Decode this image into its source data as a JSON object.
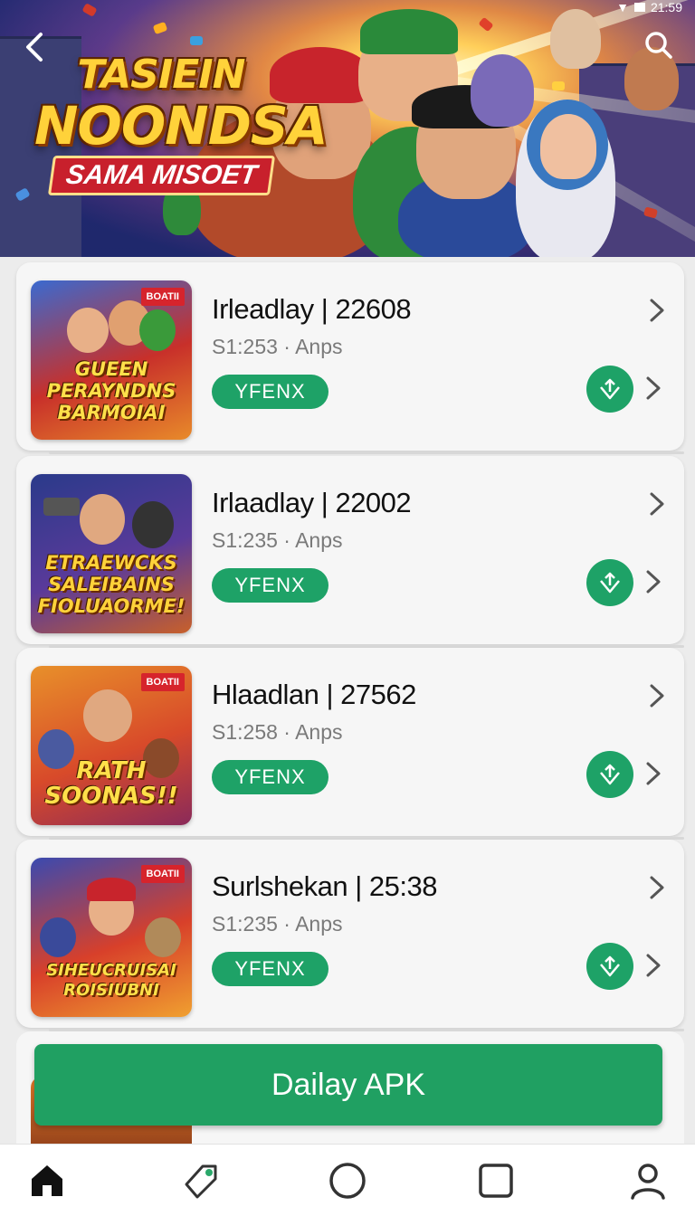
{
  "status_bar": {
    "time": "21:59"
  },
  "hero": {
    "logo_line1": "TASIEIN",
    "logo_line2": "NOONDSA",
    "logo_line3": "SAMA MISOET"
  },
  "items": [
    {
      "thumb_tag": "BOATII",
      "thumb_title": "GUEEN PERAYNDNS BARMOIAI",
      "title": "Irleadlay | 22608",
      "subtitle": "S1:253 · Anps",
      "badge": "YFENX"
    },
    {
      "thumb_tag": "",
      "thumb_title": "ETRAEWCKS SALEIBAINS FIOLUAORME!",
      "title": "Irlaadlay | 22002",
      "subtitle": "S1:235 · Anps",
      "badge": "YFENX"
    },
    {
      "thumb_tag": "BOATII",
      "thumb_title": "RATH SOONAS!!",
      "title": "Hlaadlan | 27562",
      "subtitle": "S1:258 · Anps",
      "badge": "YFENX"
    },
    {
      "thumb_tag": "BOATII",
      "thumb_title": "SIHEUCRUISAI ROISIUBNI",
      "title": "Surlshekan | 25:38",
      "subtitle": "S1:235 · Anps",
      "badge": "YFENX"
    }
  ],
  "cta": {
    "label": "Dailay APK"
  },
  "colors": {
    "accent": "#1ea267",
    "card_bg": "#f6f6f6",
    "page_bg": "#ececec"
  },
  "icons": {
    "back": "chevron-left-icon",
    "search": "search-icon",
    "download": "download-icon",
    "nav": [
      "home-icon",
      "tag-icon",
      "circle-icon",
      "square-icon",
      "user-icon"
    ]
  }
}
